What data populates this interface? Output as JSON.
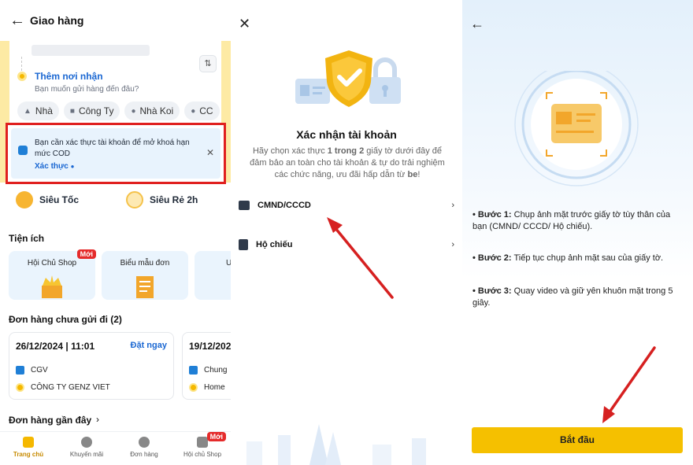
{
  "panel1": {
    "header_title": "Giao hàng",
    "add_recipient": "Thêm nơi nhận",
    "recipient_prompt": "Bạn muốn gửi hàng đến đâu?",
    "chips": [
      {
        "label": "Nhà",
        "icon": "home-icon"
      },
      {
        "label": "Công Ty",
        "icon": "briefcase-icon"
      },
      {
        "label": "Nhà Koi",
        "icon": "location-pin-icon"
      },
      {
        "label": "CC",
        "icon": "location-pin-icon"
      }
    ],
    "banner": {
      "text": "Bạn cần xác thực tài khoản để mở khoá hạn mức COD",
      "link": "Xác thực"
    },
    "services": [
      {
        "label": "Siêu Tốc"
      },
      {
        "label": "Siêu Rẻ 2h"
      }
    ],
    "utilities_title": "Tiện ích",
    "utilities": [
      {
        "label": "Hội Chủ Shop",
        "badge": "Mới"
      },
      {
        "label": "Biểu mẫu đơn"
      },
      {
        "label": "U"
      }
    ],
    "pending_orders_title": "Đơn hàng chưa gửi đi (2)",
    "orders": [
      {
        "datetime": "26/12/2024 | 11:01",
        "action": "Đặt ngay",
        "sender": "CGV",
        "receiver": "CÔNG TY GENZ VIET"
      },
      {
        "datetime": "19/12/202",
        "sender": "Chung",
        "receiver": "Home"
      }
    ],
    "recent_orders_title": "Đơn hàng gần đây",
    "nav": [
      {
        "label": "Trang chủ",
        "icon": "home-icon",
        "active": true
      },
      {
        "label": "Khuyến mãi",
        "icon": "gear-icon"
      },
      {
        "label": "Đơn hàng",
        "icon": "clock-icon"
      },
      {
        "label": "Hội chủ Shop",
        "icon": "shop-icon",
        "badge": "Mới"
      }
    ]
  },
  "panel2": {
    "title": "Xác nhận tài khoản",
    "desc_part1": "Hãy chọn xác thực ",
    "desc_bold1": "1 trong 2",
    "desc_part2": " giấy tờ dưới đây để đảm bảo an toàn cho tài khoản & tự do trải nghiệm các chức năng, ưu đãi hấp dẫn từ ",
    "desc_bold2": "be",
    "desc_part3": "!",
    "options": [
      {
        "label": "CMND/CCCD",
        "icon": "id-card-icon"
      },
      {
        "label": "Hộ chiếu",
        "icon": "passport-icon"
      }
    ]
  },
  "panel3": {
    "steps": [
      {
        "label": "• Bước 1:",
        "text": " Chụp ảnh mặt trước giấy tờ tùy thân của bạn (CMND/ CCCD/ Hộ chiếu)."
      },
      {
        "label": "• Bước 2:",
        "text": " Tiếp tục chụp ảnh mặt sau của giấy tờ."
      },
      {
        "label": "• Bước 3:",
        "text": " Quay video và giữ yên khuôn mặt trong 5 giây."
      }
    ],
    "start_button": "Bắt đầu"
  },
  "colors": {
    "accent_yellow": "#f5c000",
    "link_blue": "#1a67d2",
    "highlight_red": "#e0201f",
    "arrow_red": "#d62020"
  }
}
